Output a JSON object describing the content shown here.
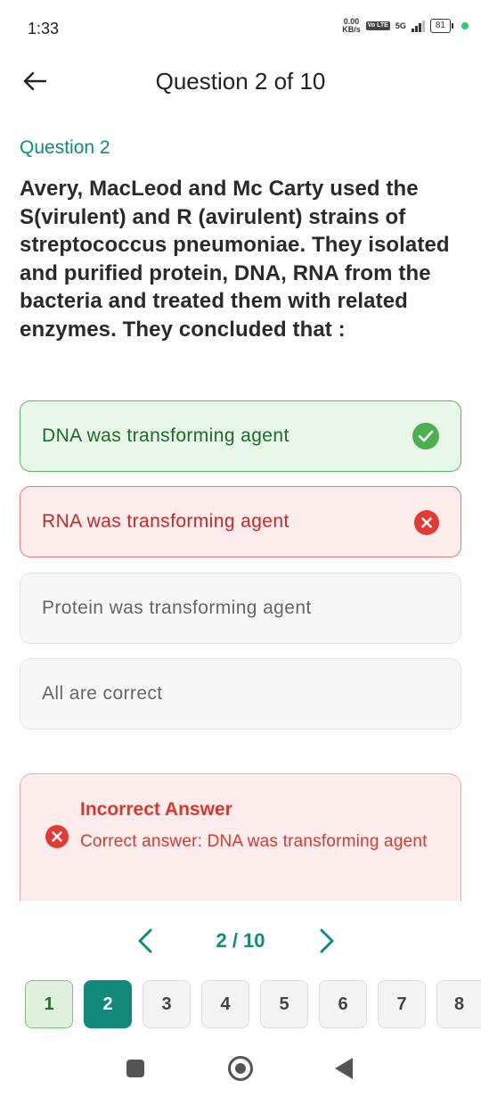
{
  "status_bar": {
    "time": "1:33",
    "net_speed_value": "0.00",
    "net_speed_unit": "KB/s",
    "volte_label": "Vo LTE",
    "network": "5G",
    "battery": "81"
  },
  "header": {
    "title": "Question 2 of 10",
    "back_icon": "arrow-left-icon"
  },
  "question": {
    "number_label": "Question 2",
    "text": "Avery, MacLeod and Mc Carty used the S(virulent) and R (avirulent) strains of streptococcus pneumoniae. They isolated and purified protein, DNA, RNA from the bacteria and treated them with related enzymes. They concluded that :"
  },
  "options": [
    {
      "label": "DNA was transforming agent",
      "state": "correct",
      "icon": "check-circle-icon"
    },
    {
      "label": "RNA was transforming agent",
      "state": "wrong",
      "icon": "x-circle-icon"
    },
    {
      "label": "Protein was transforming agent",
      "state": "neutral"
    },
    {
      "label": "All are correct",
      "state": "neutral"
    }
  ],
  "feedback": {
    "title": "Incorrect Answer",
    "text": "Correct answer: DNA was transforming agent",
    "icon": "x-circle-icon"
  },
  "pager": {
    "label": "2 / 10",
    "prev_icon": "chevron-left-icon",
    "next_icon": "chevron-right-icon"
  },
  "question_nav": [
    {
      "label": "1",
      "state": "done"
    },
    {
      "label": "2",
      "state": "active"
    },
    {
      "label": "3",
      "state": "pending"
    },
    {
      "label": "4",
      "state": "pending"
    },
    {
      "label": "5",
      "state": "pending"
    },
    {
      "label": "6",
      "state": "pending"
    },
    {
      "label": "7",
      "state": "pending"
    },
    {
      "label": "8",
      "state": "pending"
    }
  ],
  "colors": {
    "accent": "#0e8a7e",
    "correct": "#4caf50",
    "wrong": "#e53935"
  }
}
